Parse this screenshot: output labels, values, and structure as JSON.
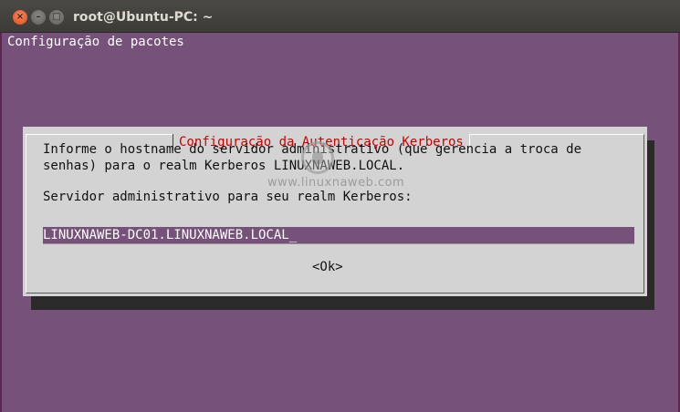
{
  "window": {
    "title": "root@Ubuntu-PC: ~",
    "controls": {
      "close": "×",
      "minimize": "–",
      "maximize": "□"
    }
  },
  "terminal": {
    "header_line": "Configuração de pacotes"
  },
  "dialog": {
    "title": "Configuração da Autenticação Kerberos",
    "description_line1": "Informe o hostname do servidor administrativo (que gerencia a troca de",
    "description_line2": "senhas) para o realm Kerberos LINUXNAWEB.LOCAL.",
    "prompt": "Servidor administrativo para seu realm Kerberos:",
    "input_value": "LINUXNAWEB-DC01.LINUXNAWEB.LOCAL_",
    "ok_label": "<Ok>"
  },
  "watermark": {
    "text": "www.linuxnaweb.com"
  },
  "colors": {
    "terminal_bg": "#76517a",
    "dialog_bg": "#d3d3d3",
    "dialog_title": "#cc0000",
    "titlebar": "#3c3b37"
  }
}
